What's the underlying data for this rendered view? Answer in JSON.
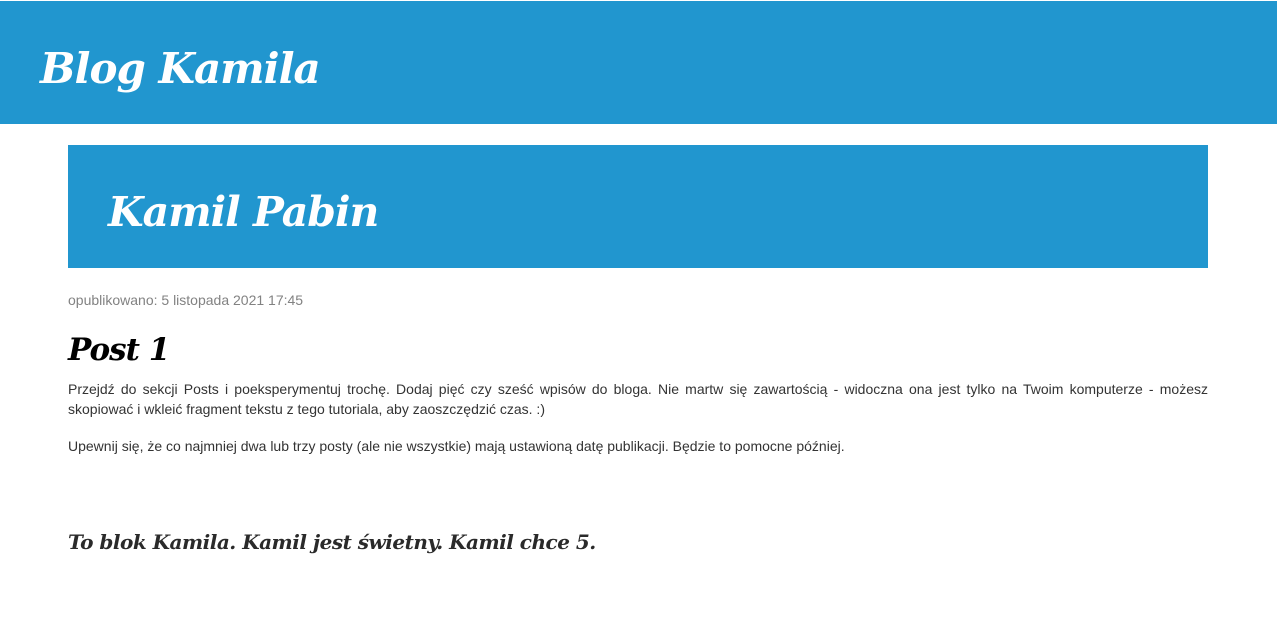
{
  "header": {
    "site_title": "Blog Kamila"
  },
  "author_banner": {
    "name": "Kamil Pabin"
  },
  "post": {
    "date": "opublikowano: 5 listopada 2021 17:45",
    "title": "Post 1",
    "paragraphs": [
      "Przejdź do sekcji Posts i poeksperymentuj trochę. Dodaj pięć czy sześć wpisów do bloga. Nie martw się zawartością - widoczna ona jest tylko na Twoim komputerze - możesz skopiować i wkleić fragment tekstu z tego tutoriala, aby zaoszczędzić czas. :)",
      "Upewnij się, że co najmniej dwa lub trzy posty (ale nie wszystkie) mają ustawioną datę publikacji. Będzie to pomocne później."
    ]
  },
  "footer": {
    "text": "To blok Kamila. Kamil jest świetny. Kamil chce 5."
  },
  "colors": {
    "header_bg": "#2196cf",
    "banner_bg": "#2196cf",
    "date_text": "#828282"
  }
}
